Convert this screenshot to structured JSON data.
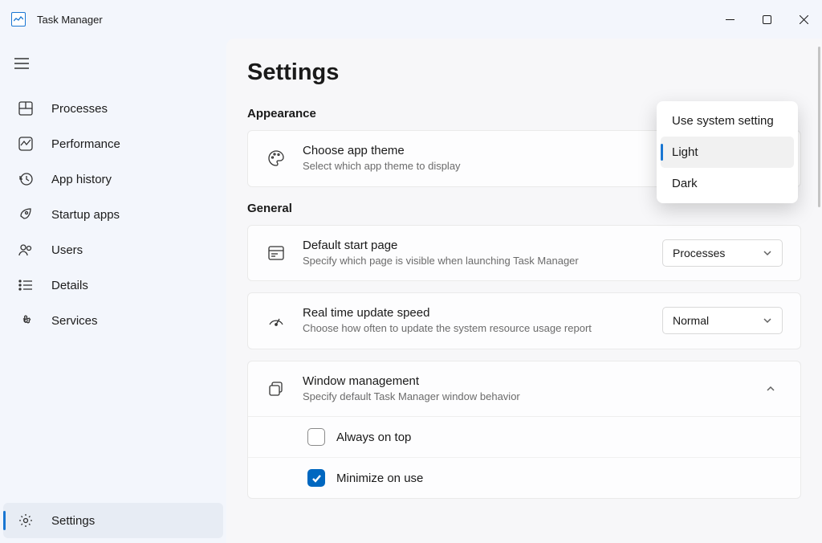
{
  "app": {
    "title": "Task Manager"
  },
  "nav": {
    "items": [
      {
        "label": "Processes"
      },
      {
        "label": "Performance"
      },
      {
        "label": "App history"
      },
      {
        "label": "Startup apps"
      },
      {
        "label": "Users"
      },
      {
        "label": "Details"
      },
      {
        "label": "Services"
      }
    ],
    "settings_label": "Settings"
  },
  "page": {
    "title": "Settings",
    "sections": {
      "appearance": {
        "heading": "Appearance",
        "theme": {
          "title": "Choose app theme",
          "subtitle": "Select which app theme to display"
        }
      },
      "general": {
        "heading": "General",
        "start_page": {
          "title": "Default start page",
          "subtitle": "Specify which page is visible when launching Task Manager",
          "value": "Processes"
        },
        "update_speed": {
          "title": "Real time update speed",
          "subtitle": "Choose how often to update the system resource usage report",
          "value": "Normal"
        },
        "window_mgmt": {
          "title": "Window management",
          "subtitle": "Specify default Task Manager window behavior",
          "options": {
            "always_on_top": {
              "label": "Always on top",
              "checked": false
            },
            "minimize_on_use": {
              "label": "Minimize on use",
              "checked": true
            }
          }
        }
      }
    }
  },
  "theme_popup": {
    "items": [
      {
        "label": "Use system setting",
        "selected": false
      },
      {
        "label": "Light",
        "selected": true
      },
      {
        "label": "Dark",
        "selected": false
      }
    ]
  }
}
